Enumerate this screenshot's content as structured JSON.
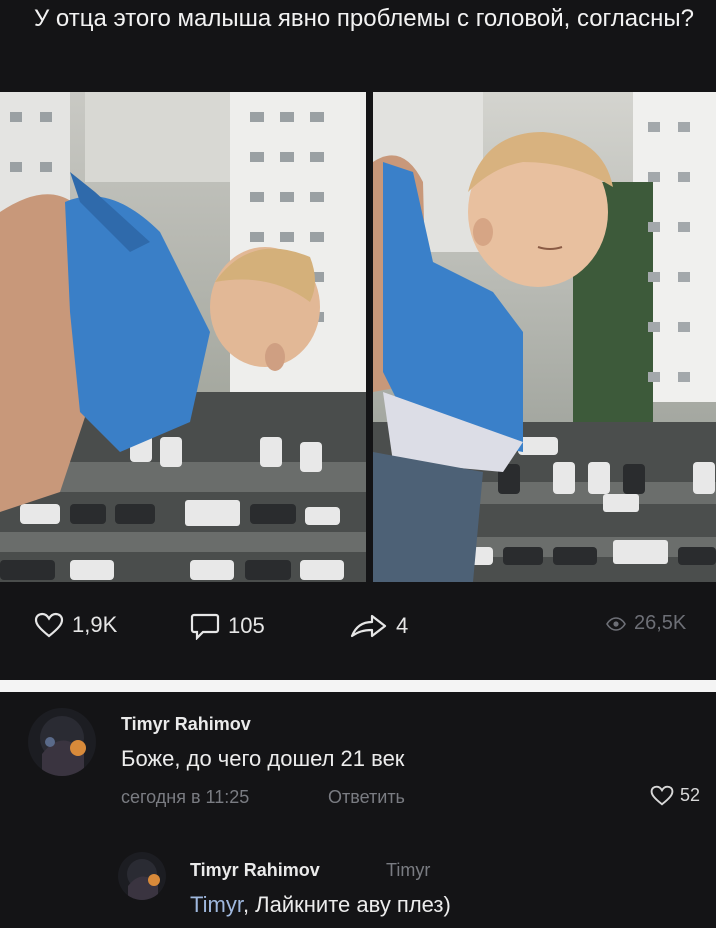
{
  "post": {
    "text": "У отца этого малыша явно проблемы с головой, согласны?"
  },
  "stats": {
    "likes": "1,9K",
    "comments": "105",
    "shares": "4",
    "views": "26,5K"
  },
  "comments": [
    {
      "author": "Timyr Rahimov",
      "text": "Боже, до чего дошел 21 век",
      "time": "сегодня в 11:25",
      "reply_label": "Ответить",
      "likes": "52"
    }
  ],
  "reply": {
    "author": "Timyr Rahimov",
    "reply_to": "Timyr",
    "mention": "Timyr",
    "text": ", Лайкните аву плез)"
  },
  "colors": {
    "background": "#141416",
    "muted": "#7a7c82",
    "mention": "#9fb8de",
    "divider": "#f4f4f4"
  },
  "icons": [
    "heart-icon",
    "comment-icon",
    "share-icon",
    "eye-icon"
  ]
}
